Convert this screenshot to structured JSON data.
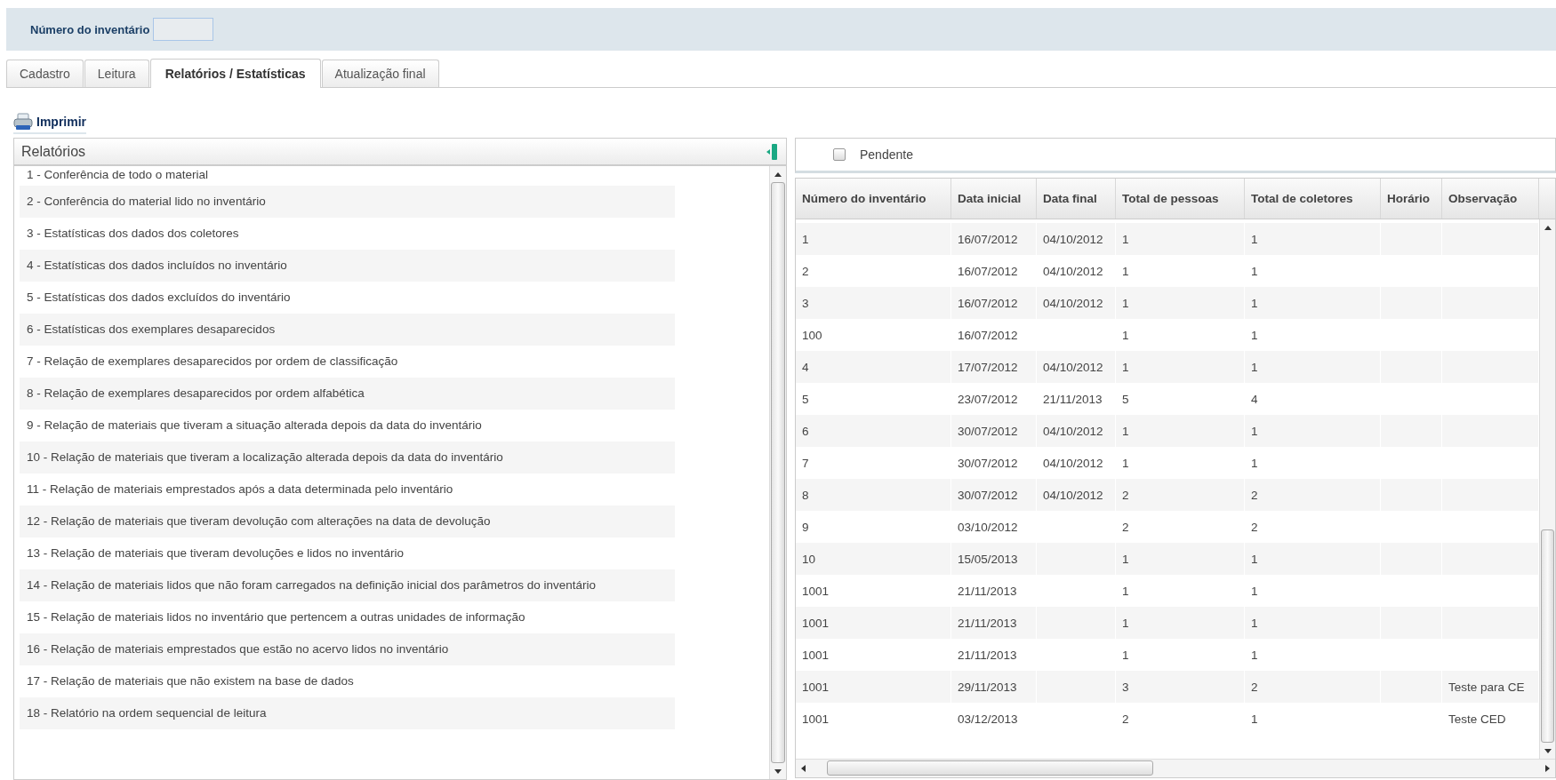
{
  "header": {
    "label": "Número do inventário"
  },
  "tabs": [
    {
      "label": "Cadastro",
      "selected": false
    },
    {
      "label": "Leitura",
      "selected": false
    },
    {
      "label": "Relatórios / Estatísticas",
      "selected": true
    },
    {
      "label": "Atualização final",
      "selected": false
    }
  ],
  "print_button": {
    "label": "Imprimir"
  },
  "reports_panel": {
    "title": "Relatórios",
    "items": [
      "1 - Conferência de todo o material",
      "2 - Conferência do material lido no inventário",
      "3 - Estatísticas dos dados dos coletores",
      "4 - Estatísticas dos dados incluídos no inventário",
      "5 - Estatísticas dos dados excluídos do inventário",
      "6 - Estatísticas dos exemplares desaparecidos",
      "7 - Relação de exemplares desaparecidos por ordem de classificação",
      "8 - Relação de exemplares desaparecidos por ordem alfabética",
      "9 - Relação de materiais que tiveram a situação alterada depois da data do inventário",
      "10 - Relação de materiais que tiveram a localização alterada depois da data do inventário",
      "11 - Relação de materiais emprestados após a data determinada pelo inventário",
      "12 - Relação de materiais que tiveram devolução com alterações na data de devolução",
      "13 - Relação de materiais que tiveram devoluções e lidos no inventário",
      "14 - Relação de materiais lidos que não foram carregados na definição inicial dos parâmetros do inventário",
      "15 - Relação de materiais lidos no inventário que pertencem a outras unidades de informação",
      "16 - Relação de materiais emprestados que estão no acervo lidos no inventário",
      "17 - Relação de materiais que não existem na base de dados",
      "18 - Relatório na ordem sequencial de leitura"
    ]
  },
  "filter": {
    "label": "Pendente",
    "checked": false
  },
  "table": {
    "columns": [
      "Número do inventário",
      "Data inicial",
      "Data final",
      "Total de pessoas",
      "Total de coletores",
      "Horário",
      "Observação"
    ],
    "rows": [
      [
        "1",
        "16/07/2012",
        "04/10/2012",
        "1",
        "1",
        null,
        null
      ],
      [
        "2",
        "16/07/2012",
        "04/10/2012",
        "1",
        "1",
        null,
        null
      ],
      [
        "3",
        "16/07/2012",
        "04/10/2012",
        "1",
        "1",
        null,
        null
      ],
      [
        "100",
        "16/07/2012",
        null,
        "1",
        "1",
        null,
        null
      ],
      [
        "4",
        "17/07/2012",
        "04/10/2012",
        "1",
        "1",
        null,
        null
      ],
      [
        "5",
        "23/07/2012",
        "21/11/2013",
        "5",
        "4",
        null,
        null
      ],
      [
        "6",
        "30/07/2012",
        "04/10/2012",
        "1",
        "1",
        null,
        null
      ],
      [
        "7",
        "30/07/2012",
        "04/10/2012",
        "1",
        "1",
        null,
        null
      ],
      [
        "8",
        "30/07/2012",
        "04/10/2012",
        "2",
        "2",
        null,
        null
      ],
      [
        "9",
        "03/10/2012",
        null,
        "2",
        "2",
        null,
        null
      ],
      [
        "10",
        "15/05/2013",
        null,
        "1",
        "1",
        null,
        null
      ],
      [
        "1001",
        "21/11/2013",
        null,
        "1",
        "1",
        null,
        null
      ],
      [
        "1001",
        "21/11/2013",
        null,
        "1",
        "1",
        null,
        null
      ],
      [
        "1001",
        "21/11/2013",
        null,
        "1",
        "1",
        null,
        null
      ],
      [
        "1001",
        "29/11/2013",
        null,
        "3",
        "2",
        null,
        "Teste para CE"
      ],
      [
        "1001",
        "03/12/2013",
        null,
        "2",
        "1",
        null,
        "Teste CED"
      ]
    ]
  }
}
